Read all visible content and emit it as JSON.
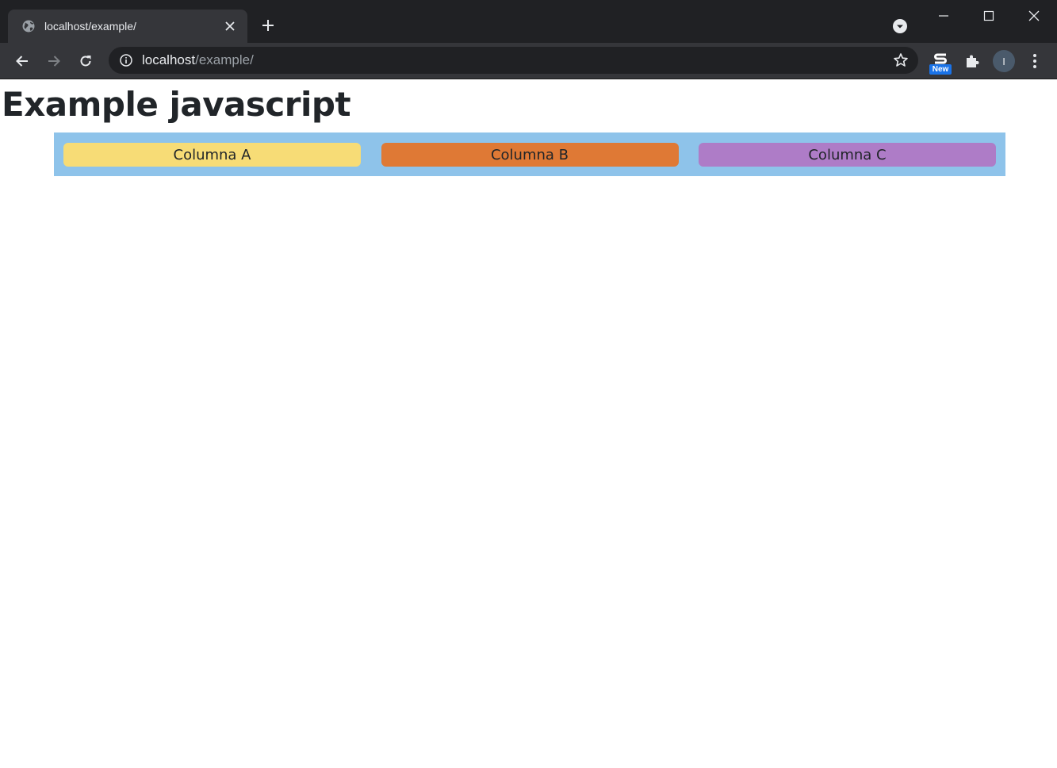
{
  "browser": {
    "tab": {
      "title": "localhost/example/"
    },
    "address_bar": {
      "host": "localhost",
      "path": "/example/"
    },
    "extension_badge": {
      "label": "New"
    },
    "profile": {
      "initial": "I"
    }
  },
  "page": {
    "heading": "Example javascript",
    "columns": [
      {
        "label": "Columna A",
        "color": "#f7dc76"
      },
      {
        "label": "Columna B",
        "color": "#df7935"
      },
      {
        "label": "Columna C",
        "color": "#ae7cc7"
      }
    ],
    "row_color": "#8ec3ea"
  },
  "icons": {
    "tab_favicon": "globe-icon",
    "tab_close": "close-icon",
    "new_tab": "plus-icon",
    "tab_search": "chevron-down-circle-icon",
    "minimize": "minimize-icon",
    "maximize": "maximize-icon",
    "close_window": "close-icon",
    "back": "arrow-left-icon",
    "forward": "arrow-right-icon",
    "reload": "reload-icon",
    "site_info": "info-icon",
    "bookmark": "star-icon",
    "extensions": "puzzle-icon",
    "menu": "kebab-menu-icon"
  }
}
